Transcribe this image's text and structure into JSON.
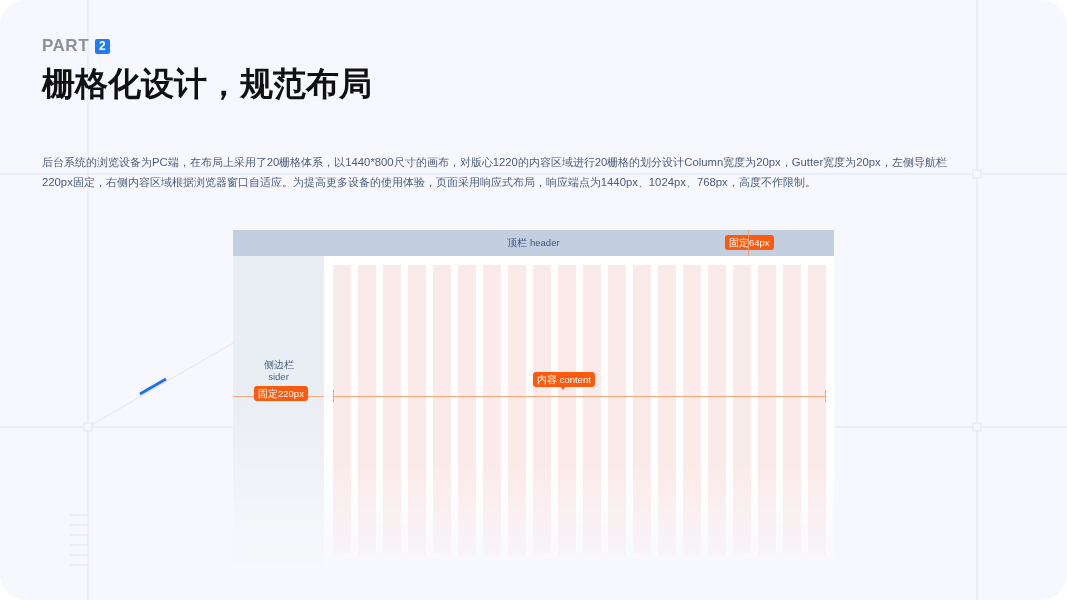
{
  "part": {
    "label": "PART",
    "number": "2"
  },
  "title": "栅格化设计，规范布局",
  "description": "后台系统的浏览设备为PC端，在布局上采用了20栅格体系，以1440*800尺寸的画布，对版心1220的内容区域进行20栅格的划分设计Column宽度为20px，Gutter宽度为20px，左侧导航栏220px固定，右侧内容区域根据浏览器窗口自适应。为提高更多设备的使用体验，页面采用响应式布局，响应端点为1440px、1024px、768px，高度不作限制。",
  "mockup": {
    "header": {
      "label": "顶栏 header",
      "tag": "固定64px"
    },
    "sider": {
      "label": "侧边栏 sider",
      "tag": "固定220px"
    },
    "content": {
      "tag": "内容 content"
    }
  }
}
